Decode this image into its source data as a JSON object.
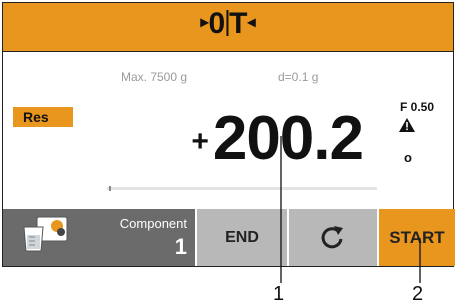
{
  "header": {
    "zero_label": "0",
    "tare_label": "T",
    "bg_color": "#e8961e"
  },
  "info": {
    "max_capacity": "Max. 7500 g",
    "readability": "d=0.1 g"
  },
  "display": {
    "res_label": "Res",
    "sign": "+",
    "weight_value": "200.2",
    "f_value": "F 0.50",
    "o_indicator": "o",
    "warning_icon": "warning-triangle-icon",
    "progress_fraction": 0.01
  },
  "bottom": {
    "component_icon": "container-component-icon",
    "component_label": "Component",
    "component_number": "1",
    "end_label": "END",
    "refresh_icon": "refresh-icon",
    "start_label": "START",
    "accent_color": "#e8961e",
    "gray_color": "#b8b8b8"
  },
  "callouts": [
    "1",
    "2"
  ]
}
